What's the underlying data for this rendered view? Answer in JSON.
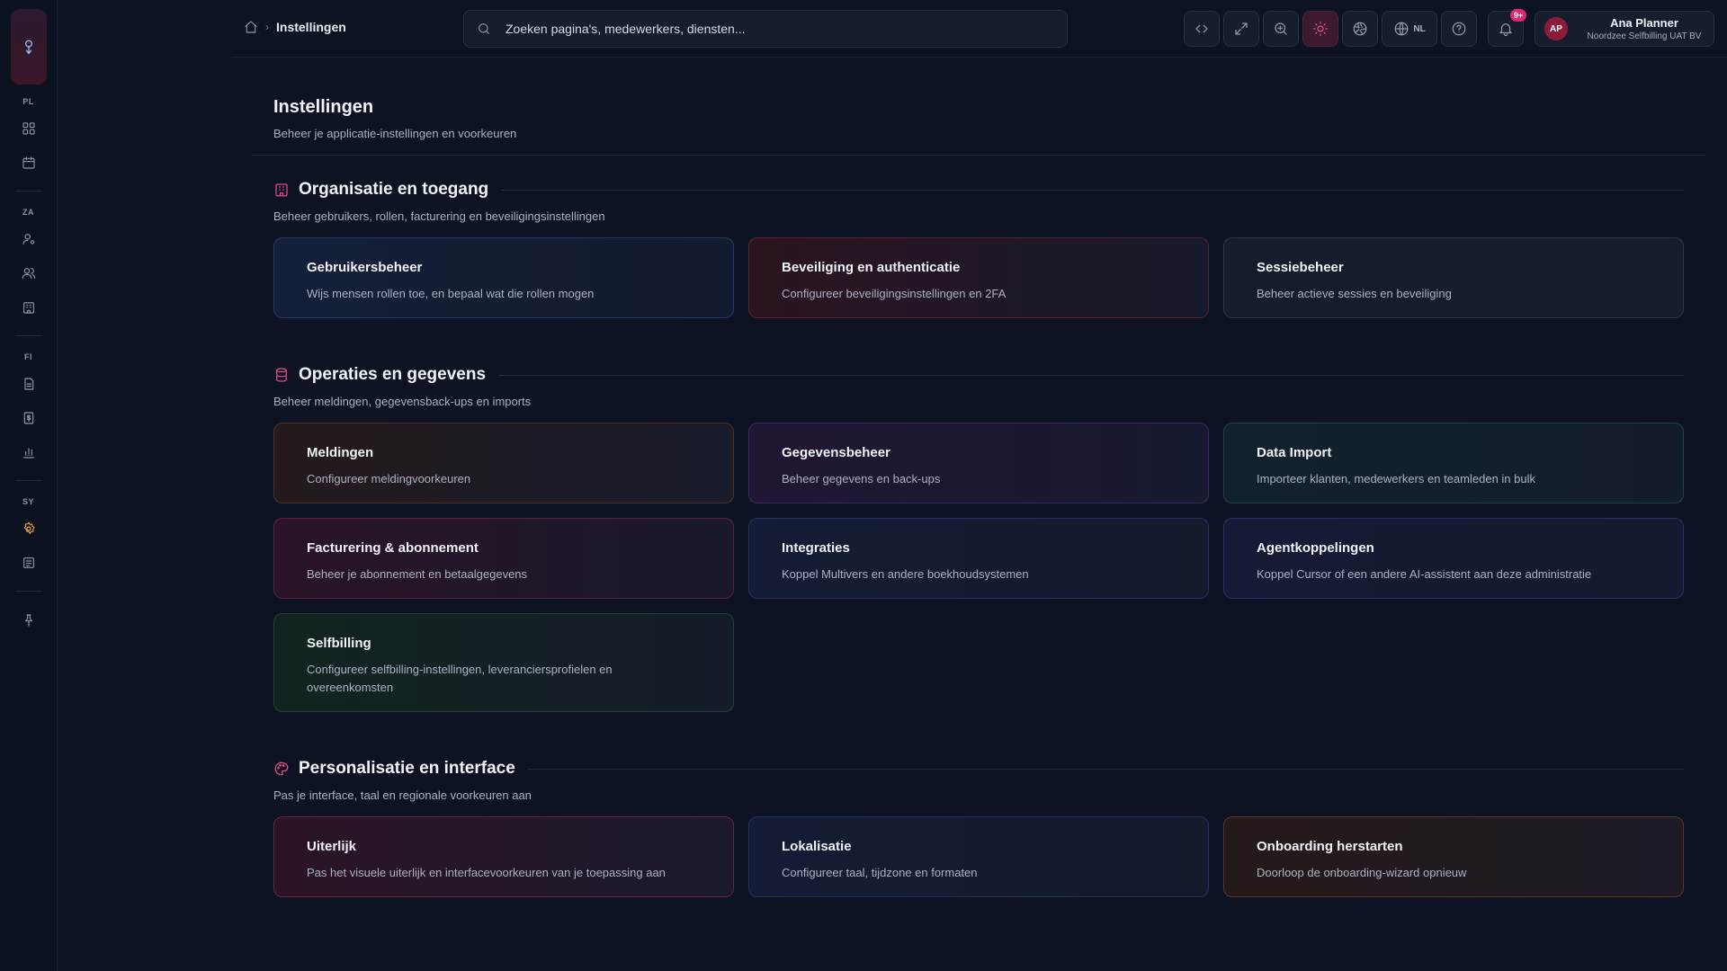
{
  "sidebar": {
    "groups": [
      {
        "label": "PL",
        "icons": [
          "dashboard-icon",
          "calendar-icon"
        ]
      },
      {
        "label": "ZA",
        "icons": [
          "user-settings-icon",
          "users-icon",
          "building-icon"
        ]
      },
      {
        "label": "FI",
        "icons": [
          "document-icon",
          "invoice-icon",
          "chart-icon"
        ]
      },
      {
        "label": "SY",
        "icons": [
          "settings-icon",
          "log-icon"
        ]
      }
    ],
    "active": "settings-icon"
  },
  "header": {
    "breadcrumb_current": "Instellingen",
    "search_placeholder": "Zoeken pagina's, medewerkers, diensten...",
    "language": "NL",
    "notification_badge": "9+",
    "user": {
      "initials": "AP",
      "name": "Ana Planner",
      "org": "Noordzee Selfbilling UAT BV"
    }
  },
  "page": {
    "title": "Instellingen",
    "subtitle": "Beheer je applicatie-instellingen en voorkeuren"
  },
  "sections": [
    {
      "title": "Organisatie en toegang",
      "subtitle": "Beheer gebruikers, rollen, facturering en beveiligingsinstellingen",
      "cards": [
        {
          "title": "Gebruikersbeheer",
          "desc": "Wijs mensen rollen toe, en bepaal wat die rollen mogen"
        },
        {
          "title": "Beveiliging en authenticatie",
          "desc": "Configureer beveiligingsinstellingen en 2FA"
        },
        {
          "title": "Sessiebeheer",
          "desc": "Beheer actieve sessies en beveiliging"
        }
      ]
    },
    {
      "title": "Operaties en gegevens",
      "subtitle": "Beheer meldingen, gegevensback-ups en imports",
      "cards": [
        {
          "title": "Meldingen",
          "desc": "Configureer meldingvoorkeuren"
        },
        {
          "title": "Gegevensbeheer",
          "desc": "Beheer gegevens en back-ups"
        },
        {
          "title": "Data Import",
          "desc": "Importeer klanten, medewerkers en teamleden in bulk"
        },
        {
          "title": "Facturering & abonnement",
          "desc": "Beheer je abonnement en betaalgegevens"
        },
        {
          "title": "Integraties",
          "desc": "Koppel Multivers en andere boekhoudsystemen"
        },
        {
          "title": "Agentkoppelingen",
          "desc": "Koppel Cursor of een andere AI-assistent aan deze administratie"
        },
        {
          "title": "Selfbilling",
          "desc": "Configureer selfbilling-instellingen, leveranciersprofielen en overeenkomsten"
        }
      ]
    },
    {
      "title": "Personalisatie en interface",
      "subtitle": "Pas je interface, taal en regionale voorkeuren aan",
      "cards": [
        {
          "title": "Uiterlijk",
          "desc": "Pas het visuele uiterlijk en interfacevoorkeuren van je toepassing aan"
        },
        {
          "title": "Lokalisatie",
          "desc": "Configureer taal, tijdzone en formaten"
        },
        {
          "title": "Onboarding herstarten",
          "desc": "Doorloop de onboarding-wizard opnieuw"
        }
      ]
    }
  ]
}
